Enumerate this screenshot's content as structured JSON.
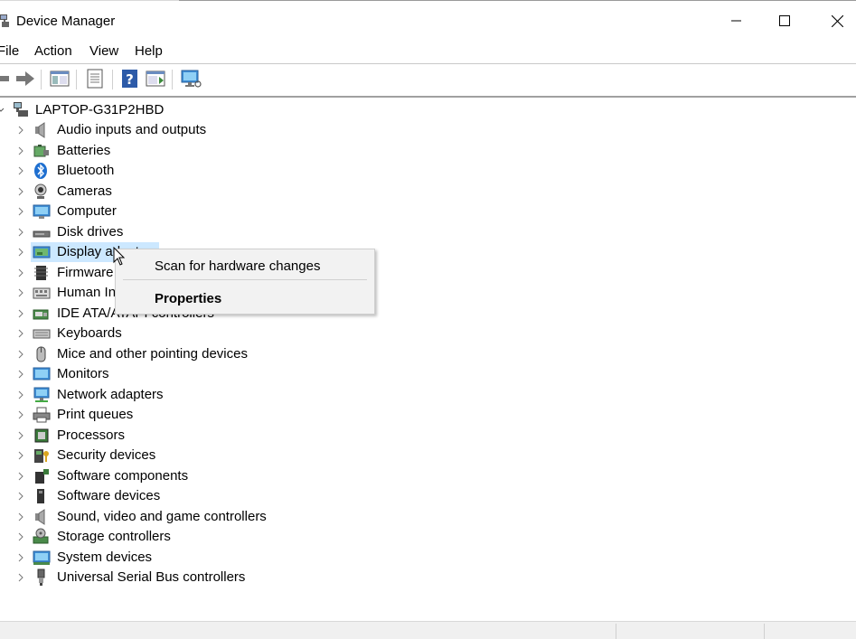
{
  "window": {
    "title": "Device Manager",
    "minimize_label": "Minimize",
    "maximize_label": "Maximize",
    "close_label": "Close"
  },
  "menu": {
    "items": [
      "File",
      "Action",
      "View",
      "Help"
    ]
  },
  "toolbar": {
    "icons": [
      "back-arrow-icon",
      "forward-arrow-icon",
      "show-hide-console-tree-icon",
      "properties-icon",
      "help-icon",
      "action-pane-icon",
      "monitor-scan-icon"
    ]
  },
  "tree": {
    "root": "LAPTOP-G31P2HBD",
    "items": [
      {
        "label": "Audio inputs and outputs",
        "icon": "speaker-icon"
      },
      {
        "label": "Batteries",
        "icon": "battery-icon"
      },
      {
        "label": "Bluetooth",
        "icon": "bluetooth-icon"
      },
      {
        "label": "Cameras",
        "icon": "camera-icon"
      },
      {
        "label": "Computer",
        "icon": "computer-icon"
      },
      {
        "label": "Disk drives",
        "icon": "disk-drive-icon"
      },
      {
        "label": "Display adapters",
        "icon": "display-adapter-icon"
      },
      {
        "label": "Firmware",
        "icon": "firmware-icon"
      },
      {
        "label": "Human Interface Devices",
        "icon": "hid-icon"
      },
      {
        "label": "IDE ATA/ATAPI controllers",
        "icon": "ide-controller-icon"
      },
      {
        "label": "Keyboards",
        "icon": "keyboard-icon"
      },
      {
        "label": "Mice and other pointing devices",
        "icon": "mouse-icon"
      },
      {
        "label": "Monitors",
        "icon": "monitor-icon"
      },
      {
        "label": "Network adapters",
        "icon": "network-adapter-icon"
      },
      {
        "label": "Print queues",
        "icon": "printer-icon"
      },
      {
        "label": "Processors",
        "icon": "processor-icon"
      },
      {
        "label": "Security devices",
        "icon": "security-device-icon"
      },
      {
        "label": "Software components",
        "icon": "software-component-icon"
      },
      {
        "label": "Software devices",
        "icon": "software-device-icon"
      },
      {
        "label": "Sound, video and game controllers",
        "icon": "sound-controller-icon"
      },
      {
        "label": "Storage controllers",
        "icon": "storage-controller-icon"
      },
      {
        "label": "System devices",
        "icon": "system-device-icon"
      },
      {
        "label": "Universal Serial Bus controllers",
        "icon": "usb-icon"
      }
    ],
    "selected": "Display adapters"
  },
  "context_menu": {
    "scan_label": "Scan for hardware changes",
    "properties_label": "Properties"
  },
  "colors": {
    "selection": "#cce8ff",
    "menu_bg": "#f2f2f2"
  }
}
